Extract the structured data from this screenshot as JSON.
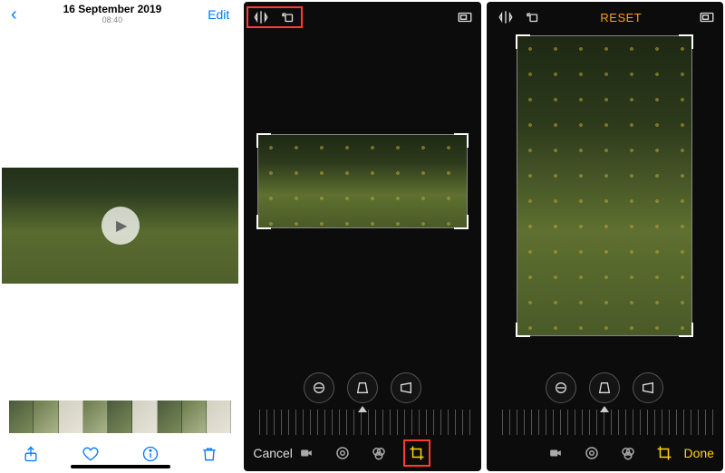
{
  "phone1": {
    "date": "16 September 2019",
    "time": "08:40",
    "edit_label": "Edit"
  },
  "phone2": {
    "cancel_label": "Cancel"
  },
  "phone3": {
    "reset_label": "RESET",
    "done_label": "Done"
  },
  "icons": {
    "back": "‹",
    "share": "share-icon",
    "heart": "heart-icon",
    "info": "info-icon",
    "trash": "trash-icon",
    "flip": "flip-icon",
    "rotate": "rotate-icon",
    "aspect": "aspect-icon",
    "straighten": "straighten-icon",
    "hflip": "hflip-icon",
    "vflip": "vflip-icon",
    "video_mode": "video-mode-icon",
    "adjust_mode": "adjust-mode-icon",
    "filter_mode": "filter-mode-icon",
    "crop_mode": "crop-mode-icon"
  }
}
